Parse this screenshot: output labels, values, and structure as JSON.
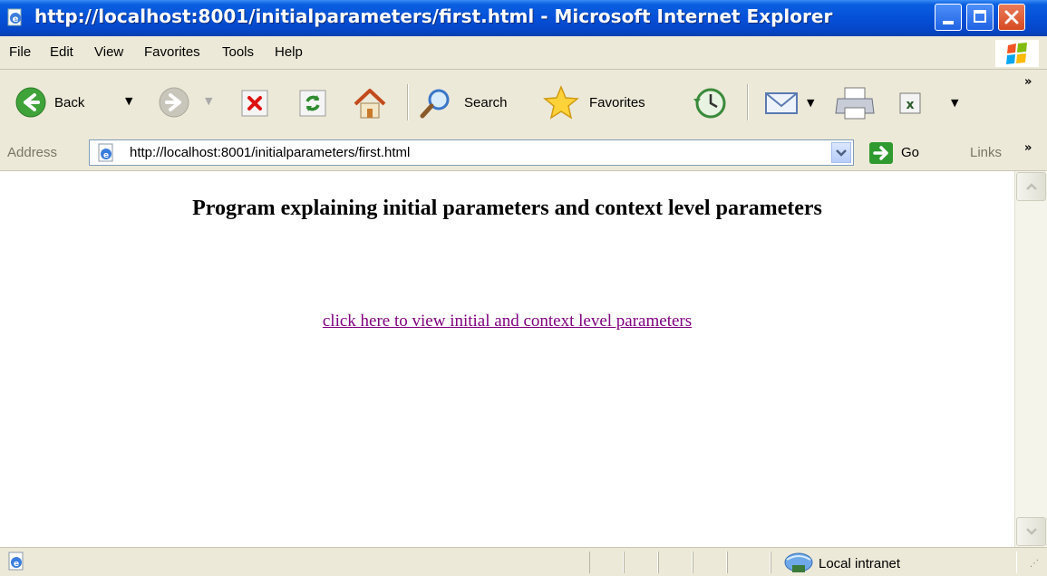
{
  "window": {
    "title": "http://localhost:8001/initialparameters/first.html - Microsoft Internet Explorer"
  },
  "menu": {
    "items": [
      "File",
      "Edit",
      "View",
      "Favorites",
      "Tools",
      "Help"
    ]
  },
  "toolbar": {
    "back_label": "Back",
    "search_label": "Search",
    "favorites_label": "Favorites"
  },
  "address": {
    "label": "Address",
    "url": "http://localhost:8001/initialparameters/first.html",
    "go_label": "Go",
    "links_label": "Links"
  },
  "page": {
    "heading": "Program explaining initial parameters and context level parameters",
    "link_text": "click here to view initial and context level parameters"
  },
  "status": {
    "zone": "Local intranet"
  },
  "colors": {
    "titlebar": "#0550d8",
    "chrome": "#ece9d8",
    "visited_link": "#800080"
  }
}
